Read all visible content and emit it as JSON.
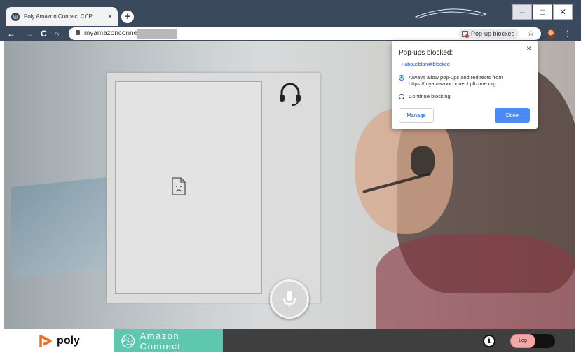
{
  "browser": {
    "tab_title": "Poly Amazon Connect CCP",
    "tab_close": "×",
    "new_tab": "+",
    "url": "myamazonconnect",
    "popup_blocked_chip": "Pop-up blocked",
    "window_controls": {
      "minimize": "–",
      "maximize": "□",
      "close": "✕"
    },
    "nav": {
      "back": "←",
      "forward": "→",
      "reload": "C",
      "home": "⌂"
    },
    "bookmark_icon": "☆",
    "menu_icon": "⋮"
  },
  "popup": {
    "title": "Pop-ups blocked:",
    "blocked_link": "about:blank#blocked",
    "option_allow": "Always allow pop-ups and redirects from https://myamazonconnect.pltzone.org",
    "option_block": "Continue blocking",
    "manage_label": "Manage",
    "done_label": "Done",
    "close": "×"
  },
  "footer": {
    "poly_label": "poly",
    "amazon_label": "Amazon Connect",
    "info_label": "i",
    "log_label": "Log"
  },
  "colors": {
    "chrome_frame": "#3a4a5c",
    "amazon_teal": "#5fc7b0",
    "poly_orange": "#f26b21",
    "done_blue": "#4c8bf5",
    "log_pink": "#f2a6a6"
  }
}
